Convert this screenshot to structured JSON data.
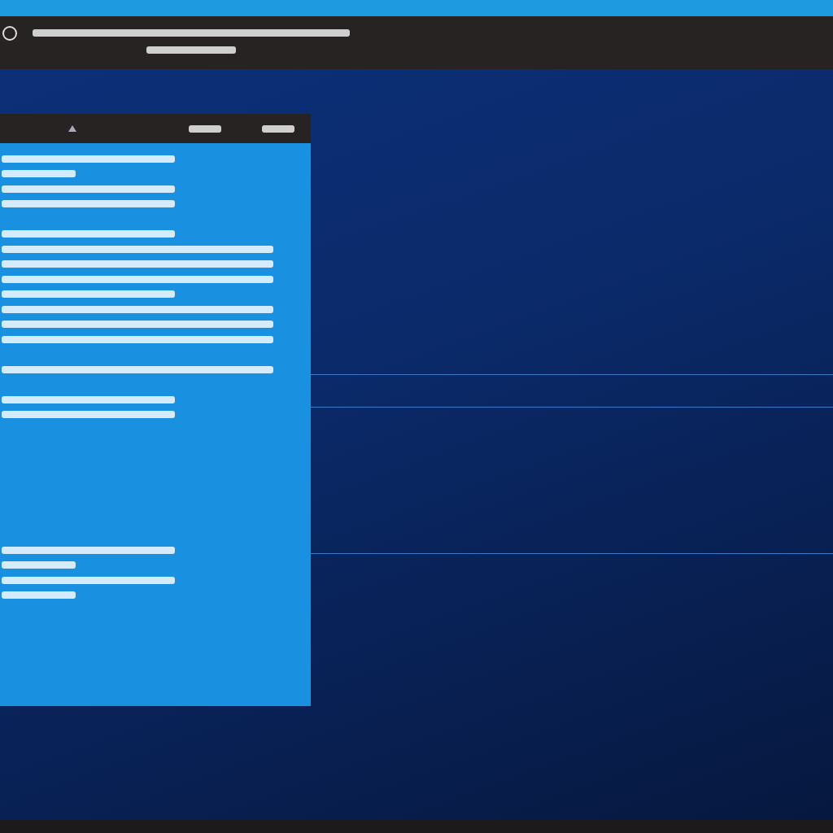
{
  "top_bar": {
    "title_lines": [
      {
        "kind": "long"
      },
      {
        "kind": "short"
      }
    ]
  },
  "dialog": {
    "header_lines": [
      {
        "kind": "short"
      },
      {
        "kind": "short"
      }
    ],
    "lines": [
      {
        "kind": "medium"
      },
      {
        "kind": "short"
      },
      {
        "kind": "medium"
      },
      {
        "kind": "medium"
      },
      {
        "kind": "blank"
      },
      {
        "kind": "medium"
      },
      {
        "kind": "long"
      },
      {
        "kind": "long"
      },
      {
        "kind": "long"
      },
      {
        "kind": "medium"
      },
      {
        "kind": "long"
      },
      {
        "kind": "long"
      },
      {
        "kind": "long"
      },
      {
        "kind": "blank"
      },
      {
        "kind": "long"
      },
      {
        "kind": "blank"
      },
      {
        "kind": "medium"
      },
      {
        "kind": "medium"
      },
      {
        "kind": "blank"
      },
      {
        "kind": "blank"
      },
      {
        "kind": "blank"
      },
      {
        "kind": "blank"
      },
      {
        "kind": "blank"
      },
      {
        "kind": "blank"
      },
      {
        "kind": "blank"
      },
      {
        "kind": "blank"
      },
      {
        "kind": "medium"
      },
      {
        "kind": "short"
      },
      {
        "kind": "medium"
      },
      {
        "kind": "short"
      }
    ]
  }
}
